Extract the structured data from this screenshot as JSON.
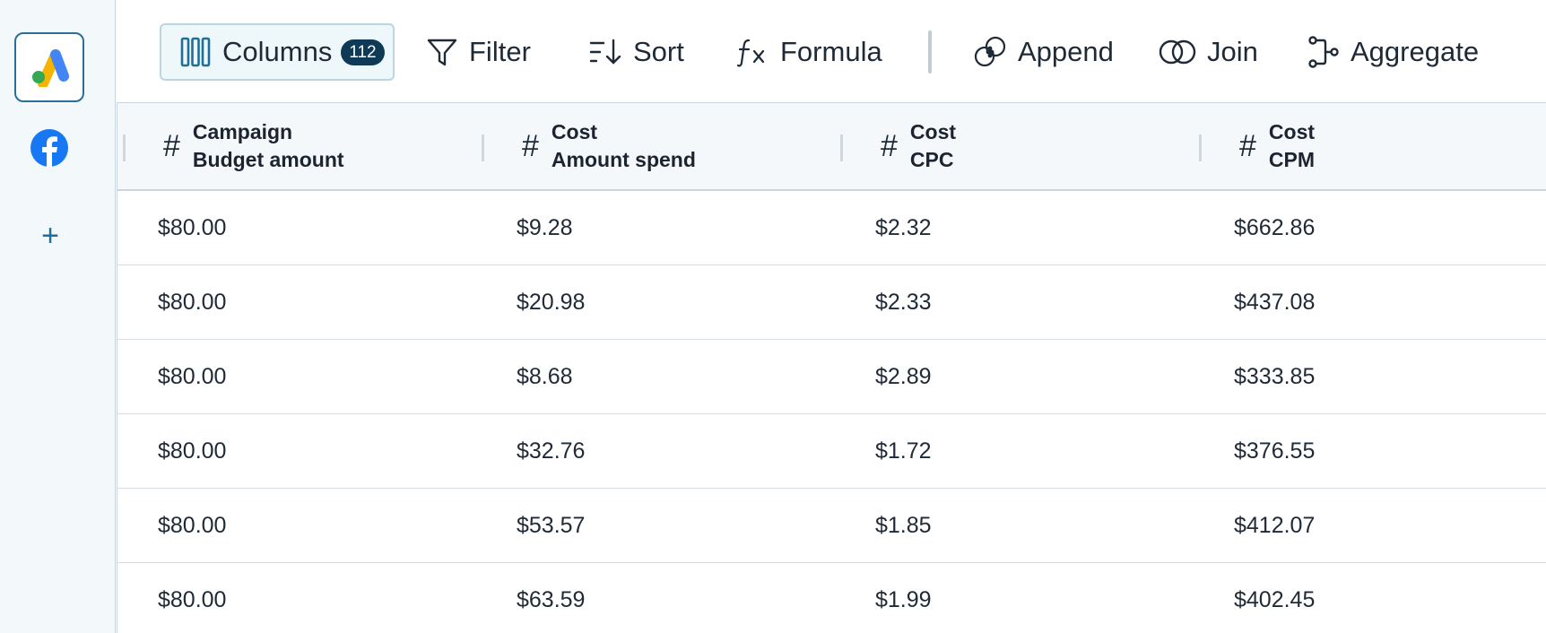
{
  "sidebar": {
    "sources": [
      {
        "name": "google-ads-icon"
      },
      {
        "name": "facebook-icon"
      }
    ],
    "add_label": "+"
  },
  "toolbar": {
    "columns_label": "Columns",
    "columns_count": "112",
    "filter_label": "Filter",
    "sort_label": "Sort",
    "formula_label": "Formula",
    "append_label": "Append",
    "join_label": "Join",
    "aggregate_label": "Aggregate"
  },
  "table": {
    "headers": [
      {
        "type_symbol": "#",
        "line1": "Campaign",
        "line2": "Budget amount"
      },
      {
        "type_symbol": "#",
        "line1": "Cost",
        "line2": "Amount spend"
      },
      {
        "type_symbol": "#",
        "line1": "Cost",
        "line2": "CPC"
      },
      {
        "type_symbol": "#",
        "line1": "Cost",
        "line2": "CPM"
      }
    ],
    "rows": [
      [
        "$80.00",
        "$9.28",
        "$2.32",
        "$662.86"
      ],
      [
        "$80.00",
        "$20.98",
        "$2.33",
        "$437.08"
      ],
      [
        "$80.00",
        "$8.68",
        "$2.89",
        "$333.85"
      ],
      [
        "$80.00",
        "$32.76",
        "$1.72",
        "$376.55"
      ],
      [
        "$80.00",
        "$53.57",
        "$1.85",
        "$412.07"
      ],
      [
        "$80.00",
        "$63.59",
        "$1.99",
        "$402.45"
      ]
    ]
  },
  "colors": {
    "accent": "#1f6f99",
    "badge": "#0e3a55",
    "sidebar_bg": "#f3f8fa",
    "header_bg": "#f4f8fa"
  }
}
